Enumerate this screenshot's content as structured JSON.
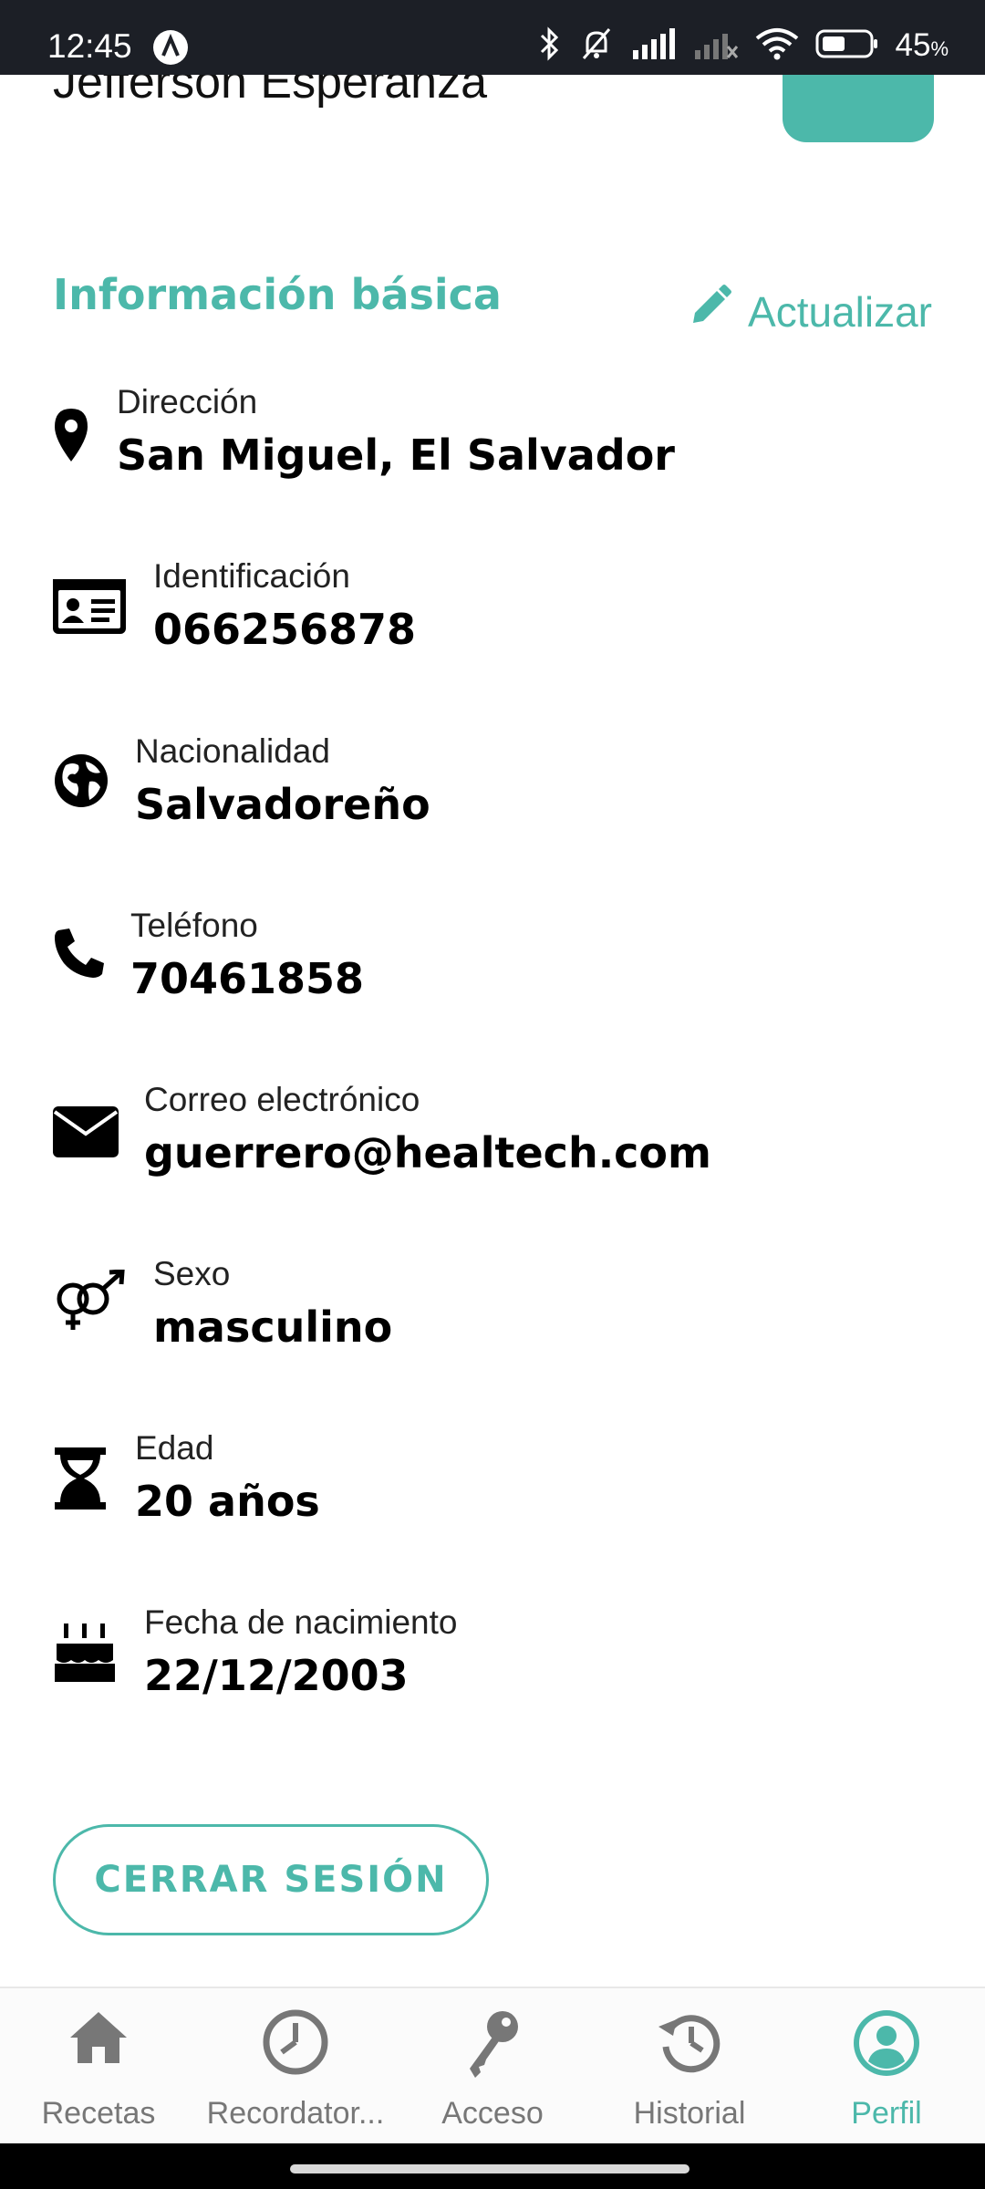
{
  "status_bar": {
    "time": "12:45",
    "battery_percent": "45",
    "battery_unit": "%",
    "icons": [
      "bluetooth-icon",
      "bell-off-icon",
      "signal-icon",
      "signal-no-icon",
      "wifi-icon",
      "battery-icon"
    ]
  },
  "profile": {
    "name": "Jefferson Esperanza"
  },
  "basic_info": {
    "title": "Información básica",
    "update_label": "Actualizar",
    "rows": [
      {
        "icon": "location-pin-icon",
        "label": "Dirección",
        "value": "San Miguel, El Salvador"
      },
      {
        "icon": "id-card-icon",
        "label": "Identificación",
        "value": "066256878"
      },
      {
        "icon": "globe-icon",
        "label": "Nacionalidad",
        "value": "Salvadoreño"
      },
      {
        "icon": "phone-icon",
        "label": "Teléfono",
        "value": "70461858"
      },
      {
        "icon": "envelope-icon",
        "label": "Correo electrónico",
        "value": "guerrero@healtech.com"
      },
      {
        "icon": "gender-icon",
        "label": "Sexo",
        "value": "masculino"
      },
      {
        "icon": "hourglass-icon",
        "label": "Edad",
        "value": "20 años"
      },
      {
        "icon": "birthday-cake-icon",
        "label": "Fecha de nacimiento",
        "value": "22/12/2003"
      }
    ]
  },
  "logout_label": "CERRAR SESIÓN",
  "nav": {
    "items": [
      {
        "label": "Recetas",
        "icon": "home-icon"
      },
      {
        "label": "Recordator...",
        "icon": "clock-icon"
      },
      {
        "label": "Acceso",
        "icon": "key-icon"
      },
      {
        "label": "Historial",
        "icon": "history-icon"
      },
      {
        "label": "Perfil",
        "icon": "user-icon"
      }
    ],
    "active": "Perfil"
  },
  "colors": {
    "accent": "#4cb8aa",
    "status_bar": "#1c1f26",
    "nav_inactive": "#777777"
  }
}
